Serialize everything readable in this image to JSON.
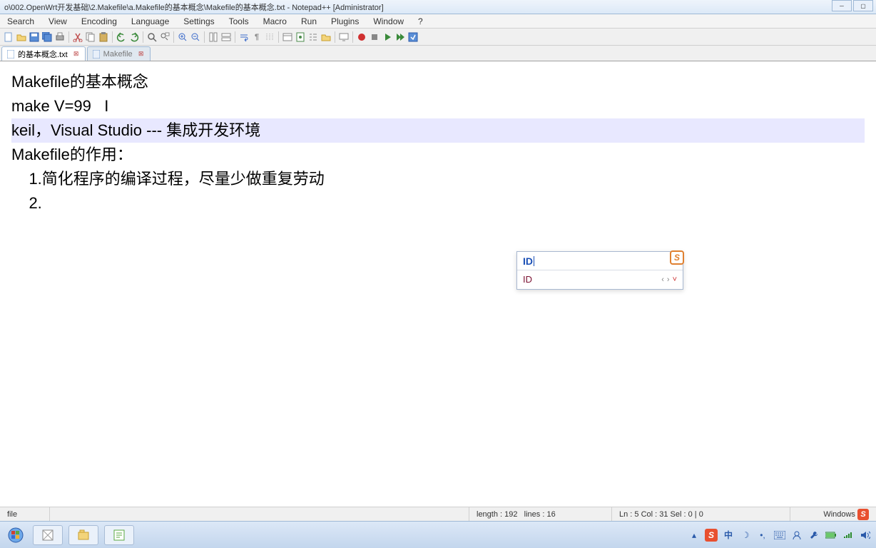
{
  "window": {
    "title": "o\\002.OpenWrt开发基础\\2.Makefile\\a.Makefile的基本概念\\Makefile的基本概念.txt - Notepad++ [Administrator]"
  },
  "menu": {
    "items": [
      "Search",
      "View",
      "Encoding",
      "Language",
      "Settings",
      "Tools",
      "Macro",
      "Run",
      "Plugins",
      "Window",
      "?"
    ]
  },
  "tabs": {
    "items": [
      {
        "label": "的基本概念.txt",
        "active": true
      },
      {
        "label": "Makefile",
        "active": false
      }
    ]
  },
  "editor": {
    "lines": [
      {
        "text": "Makefile的基本概念",
        "hl": false
      },
      {
        "text": "",
        "hl": false
      },
      {
        "text": "make V=99   I",
        "hl": false
      },
      {
        "text": "",
        "hl": false
      },
      {
        "text": "keil，Visual Studio --- 集成开发环境",
        "hl": true
      },
      {
        "text": "",
        "hl": false
      },
      {
        "text": "Makefile的作用：",
        "hl": false
      },
      {
        "text": "    1.简化程序的编译过程，尽量少做重复劳动",
        "hl": false
      },
      {
        "text": "    2.",
        "hl": false
      }
    ]
  },
  "ime": {
    "input": "ID",
    "candidate": "ID"
  },
  "status": {
    "file": "file",
    "length_label": "length : 192",
    "lines_label": "lines : 16",
    "pos_label": "Ln : 5    Col : 31    Sel : 0 | 0",
    "encoding": "Windows",
    "s_icon": "S"
  },
  "tray": {
    "cn": "中"
  },
  "colors": {
    "accent": "#2a5aaa",
    "hl_line": "#e8e8ff",
    "ime_input": "#1a4fb5",
    "ime_cand": "#7a1030",
    "sogou": "#e85030"
  }
}
